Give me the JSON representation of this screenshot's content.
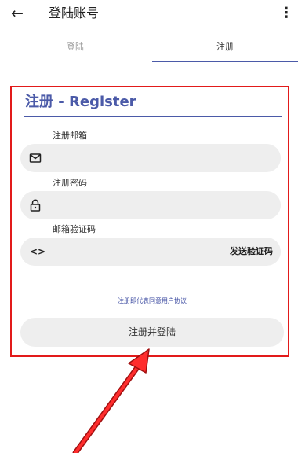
{
  "appbar": {
    "back_icon": "←",
    "title": "登陆账号",
    "more_icon": "⋮"
  },
  "tabs": [
    {
      "label": "登陆",
      "selected": false
    },
    {
      "label": "注册",
      "selected": true
    }
  ],
  "form": {
    "title": "注册 - Register",
    "email": {
      "label": "注册邮箱",
      "icon": "mail-icon",
      "value": "",
      "placeholder": ""
    },
    "password": {
      "label": "注册密码",
      "icon": "lock-icon",
      "value": "",
      "placeholder": ""
    },
    "code": {
      "label": "邮箱验证码",
      "icon": "code-icon",
      "icon_glyph": "<>",
      "value": "",
      "placeholder": "",
      "send_label": "发送验证码"
    },
    "agreement": "注册即代表同意用户协议",
    "submit_label": "注册并登陆"
  },
  "colors": {
    "accent": "#4b5aa8",
    "highlight": "#e21a1a",
    "field_bg": "#eeeeee"
  }
}
